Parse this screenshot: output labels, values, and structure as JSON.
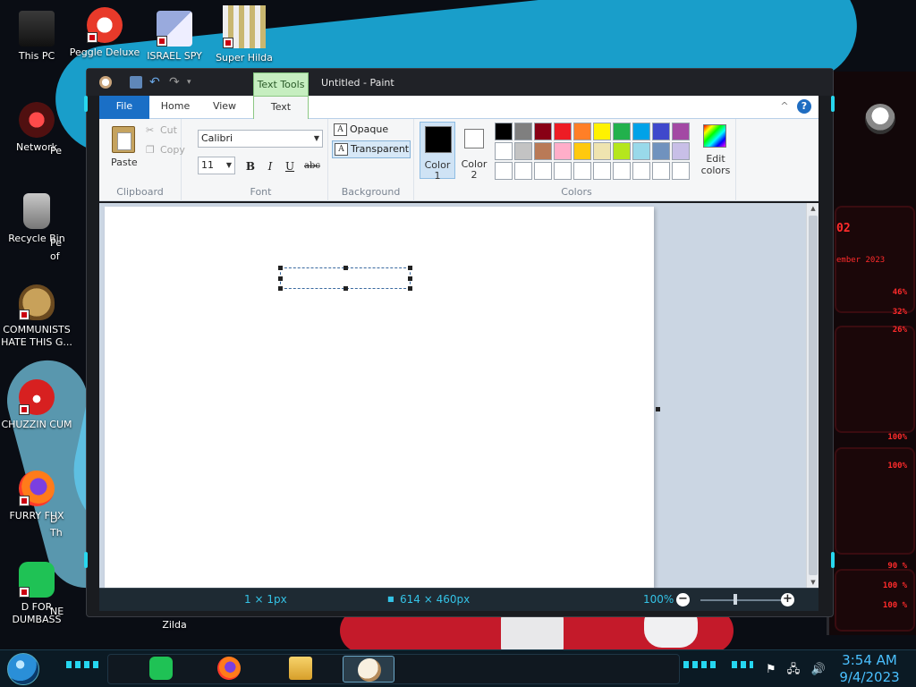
{
  "desktop": {
    "icons": [
      {
        "label": "This PC"
      },
      {
        "label": "Peggle Deluxe"
      },
      {
        "label": "ISRAEL SPY"
      },
      {
        "label": "Super Hilda"
      },
      {
        "label": "Network"
      },
      {
        "label": "Recycle Bin"
      },
      {
        "label": "COMMUNISTS HATE THIS G..."
      },
      {
        "label": "CHUZZIN CUM"
      },
      {
        "label": "FURRY FUX"
      },
      {
        "label": "D FOR DUMBASS"
      }
    ],
    "partial_labels": [
      "Pe",
      "Pe",
      "of",
      "D",
      "Th",
      "NE",
      "Zilda"
    ]
  },
  "gadget": {
    "title": "02",
    "subtitle": "ember 2023",
    "stats": [
      "46%",
      "32%",
      "26%",
      "100%",
      "100%",
      "90 %",
      "100 %",
      "100 %"
    ]
  },
  "paint": {
    "window_title": "Untitled - Paint",
    "context_tab": "Text Tools",
    "tabs": {
      "file": "File",
      "home": "Home",
      "view": "View",
      "text": "Text"
    },
    "help_symbol": "?",
    "collapse_symbol": "^",
    "clipboard": {
      "paste": "Paste",
      "cut": "Cut",
      "copy": "Copy",
      "group": "Clipboard"
    },
    "font": {
      "family": "Calibri",
      "size": "11",
      "bold": "B",
      "italic": "I",
      "underline": "U",
      "strike": "abc",
      "group": "Font"
    },
    "background": {
      "opaque": "Opaque",
      "transparent": "Transparent",
      "group": "Background",
      "icon_letter": "A"
    },
    "colors": {
      "color1_label": "Color 1",
      "color2_label": "Color 2",
      "edit_label": "Edit colors",
      "group": "Colors",
      "color1": "#000000",
      "color2": "#ffffff",
      "palette": [
        "#000000",
        "#7f7f7f",
        "#880015",
        "#ed1c24",
        "#ff7f27",
        "#fff200",
        "#22b14c",
        "#00a2e8",
        "#3f48cc",
        "#a349a4",
        "#ffffff",
        "#c3c3c3",
        "#b97a57",
        "#ffaec9",
        "#ffc90e",
        "#efe4b0",
        "#b5e61d",
        "#99d9ea",
        "#7092be",
        "#c8bfe7",
        "#ffffff",
        "#ffffff",
        "#ffffff",
        "#ffffff",
        "#ffffff",
        "#ffffff",
        "#ffffff",
        "#ffffff",
        "#ffffff",
        "#ffffff"
      ]
    },
    "status": {
      "cursor": "1 × 1px",
      "size": "614 × 460px",
      "zoom": "100%"
    }
  },
  "taskbar": {
    "clock_time": "3:54 AM",
    "clock_date": "9/4/2023"
  }
}
